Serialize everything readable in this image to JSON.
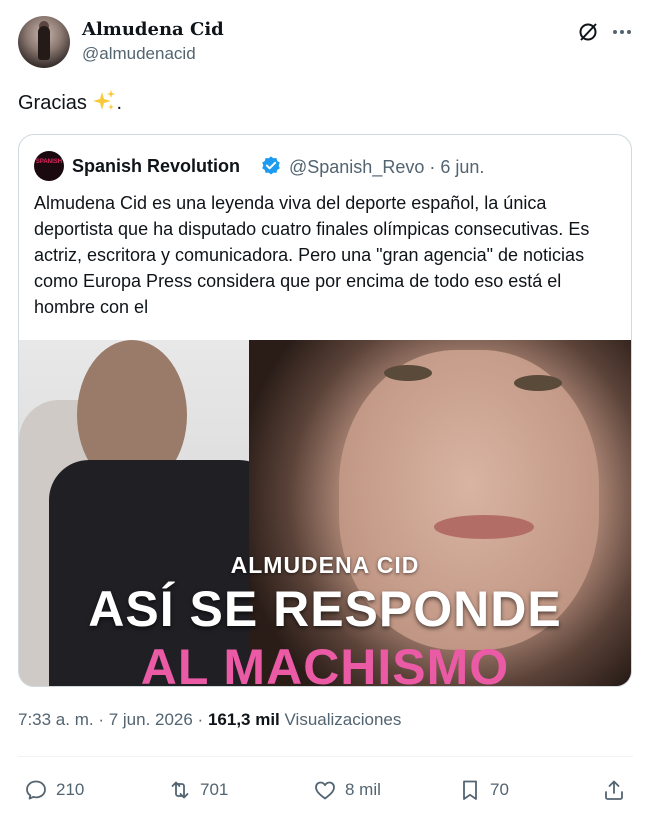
{
  "author": {
    "name": "Almudena Cid",
    "handle": "@almudenacid"
  },
  "post": {
    "text": "Gracias",
    "suffix": "."
  },
  "quote": {
    "avatar_text": "SPANISH",
    "name": "Spanish Revolution",
    "handle_date": "@Spanish_Revo · 6 jun.",
    "text": "Almudena Cid es una leyenda viva del deporte español, la única deportista que ha disputado cuatro finales olímpicas consecutivas. Es actriz, escritora y comunicadora. Pero una \"gran agencia\" de noticias como Europa Press considera que por encima de todo eso está el hombre con el",
    "media": {
      "subtitle": "ALMUDENA CID",
      "headline": "ASÍ SE RESPONDE",
      "headline_pink": "AL MACHISMO"
    }
  },
  "meta": {
    "time_date": "7:33 a. m. · 7 jun. 2026 · ",
    "views_count": "161,3 mil",
    "views_label": " Visualizaciones"
  },
  "actions": {
    "replies": "210",
    "reposts": "701",
    "likes": "8 mil",
    "bookmarks": "70"
  },
  "colors": {
    "accent": "#1d9bf0",
    "pink": "#ea5aa5",
    "secondary_text": "#536471",
    "border": "#cfd9de"
  }
}
